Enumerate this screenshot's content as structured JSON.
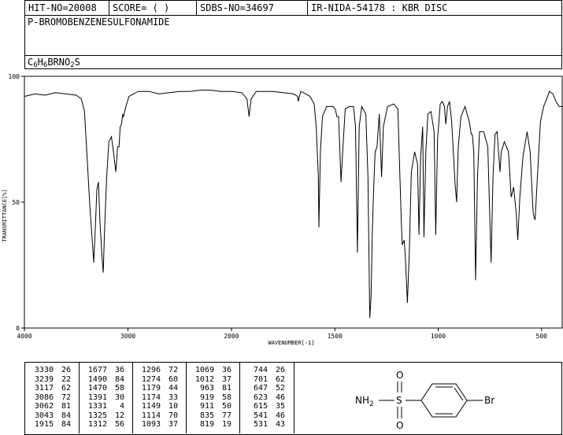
{
  "header": {
    "hit_no": "HIT-NO=20008",
    "score": "SCORE=  (   )",
    "sdbs_no": "SDBS-NO=34697",
    "ir_nida": "IR-NIDA-54178 : KBR DISC"
  },
  "compound": {
    "name": "P-BROMOBENZENESULFONAMIDE",
    "formula_parts": [
      {
        "t": "C",
        "sub": false
      },
      {
        "t": "6",
        "sub": true
      },
      {
        "t": "H",
        "sub": false
      },
      {
        "t": "6",
        "sub": true
      },
      {
        "t": "BRNO",
        "sub": false
      },
      {
        "t": "2",
        "sub": true
      },
      {
        "t": "S",
        "sub": false
      }
    ]
  },
  "chart_data": {
    "type": "line",
    "xlabel": "WAVENUMBER[-1]",
    "ylabel": "TRANSMITTANCE[%]",
    "xlim": [
      4000,
      400
    ],
    "ylim": [
      0,
      100
    ],
    "x_ticks": [
      4000,
      3000,
      2000,
      1500,
      1000,
      500
    ],
    "y_ticks": [
      0,
      50,
      100
    ],
    "series": [
      {
        "points": [
          [
            4000,
            92
          ],
          [
            3900,
            93
          ],
          [
            3800,
            92.5
          ],
          [
            3700,
            93.5
          ],
          [
            3600,
            93
          ],
          [
            3500,
            92.5
          ],
          [
            3450,
            91
          ],
          [
            3420,
            86
          ],
          [
            3400,
            72
          ],
          [
            3370,
            50
          ],
          [
            3345,
            35
          ],
          [
            3330,
            26
          ],
          [
            3315,
            40
          ],
          [
            3300,
            55
          ],
          [
            3285,
            58
          ],
          [
            3270,
            42
          ],
          [
            3250,
            28
          ],
          [
            3239,
            22
          ],
          [
            3225,
            40
          ],
          [
            3205,
            60
          ],
          [
            3185,
            74
          ],
          [
            3160,
            76
          ],
          [
            3140,
            70
          ],
          [
            3117,
            62
          ],
          [
            3100,
            72
          ],
          [
            3086,
            72
          ],
          [
            3075,
            80
          ],
          [
            3062,
            81
          ],
          [
            3050,
            85
          ],
          [
            3043,
            84
          ],
          [
            3020,
            88
          ],
          [
            2990,
            92
          ],
          [
            2950,
            93
          ],
          [
            2900,
            94
          ],
          [
            2800,
            94
          ],
          [
            2700,
            93
          ],
          [
            2600,
            93.5
          ],
          [
            2500,
            94
          ],
          [
            2400,
            94
          ],
          [
            2300,
            94.5
          ],
          [
            2200,
            94.5
          ],
          [
            2100,
            94
          ],
          [
            2000,
            94
          ],
          [
            1950,
            93.5
          ],
          [
            1925,
            91
          ],
          [
            1915,
            84
          ],
          [
            1905,
            91
          ],
          [
            1880,
            94
          ],
          [
            1800,
            94
          ],
          [
            1700,
            93
          ],
          [
            1680,
            92
          ],
          [
            1677,
            90
          ],
          [
            1665,
            94
          ],
          [
            1640,
            93
          ],
          [
            1620,
            92
          ],
          [
            1600,
            89
          ],
          [
            1590,
            80
          ],
          [
            1580,
            60
          ],
          [
            1577,
            40
          ],
          [
            1570,
            70
          ],
          [
            1560,
            84
          ],
          [
            1540,
            88
          ],
          [
            1510,
            88
          ],
          [
            1498,
            87
          ],
          [
            1490,
            84
          ],
          [
            1482,
            84
          ],
          [
            1470,
            58
          ],
          [
            1462,
            70
          ],
          [
            1450,
            87
          ],
          [
            1430,
            88
          ],
          [
            1410,
            88
          ],
          [
            1400,
            80
          ],
          [
            1391,
            30
          ],
          [
            1382,
            80
          ],
          [
            1370,
            88
          ],
          [
            1350,
            85
          ],
          [
            1340,
            60
          ],
          [
            1331,
            4
          ],
          [
            1325,
            12
          ],
          [
            1318,
            40
          ],
          [
            1312,
            56
          ],
          [
            1305,
            70
          ],
          [
            1296,
            72
          ],
          [
            1285,
            85
          ],
          [
            1274,
            60
          ],
          [
            1265,
            80
          ],
          [
            1245,
            88
          ],
          [
            1215,
            89
          ],
          [
            1195,
            87
          ],
          [
            1185,
            60
          ],
          [
            1179,
            44
          ],
          [
            1174,
            33
          ],
          [
            1165,
            35
          ],
          [
            1160,
            30
          ],
          [
            1149,
            10
          ],
          [
            1140,
            30
          ],
          [
            1130,
            62
          ],
          [
            1114,
            70
          ],
          [
            1100,
            65
          ],
          [
            1093,
            37
          ],
          [
            1085,
            68
          ],
          [
            1075,
            80
          ],
          [
            1069,
            36
          ],
          [
            1060,
            70
          ],
          [
            1050,
            85
          ],
          [
            1035,
            86
          ],
          [
            1020,
            78
          ],
          [
            1012,
            37
          ],
          [
            1003,
            75
          ],
          [
            990,
            89
          ],
          [
            980,
            90
          ],
          [
            970,
            88
          ],
          [
            963,
            81
          ],
          [
            955,
            88
          ],
          [
            945,
            90
          ],
          [
            935,
            82
          ],
          [
            919,
            58
          ],
          [
            911,
            50
          ],
          [
            903,
            72
          ],
          [
            890,
            84
          ],
          [
            870,
            88
          ],
          [
            850,
            82
          ],
          [
            840,
            77
          ],
          [
            835,
            77
          ],
          [
            828,
            70
          ],
          [
            819,
            19
          ],
          [
            810,
            60
          ],
          [
            800,
            78
          ],
          [
            780,
            78
          ],
          [
            760,
            72
          ],
          [
            744,
            26
          ],
          [
            735,
            60
          ],
          [
            725,
            77
          ],
          [
            715,
            78
          ],
          [
            701,
            62
          ],
          [
            695,
            70
          ],
          [
            680,
            74
          ],
          [
            660,
            70
          ],
          [
            647,
            52
          ],
          [
            635,
            56
          ],
          [
            623,
            46
          ],
          [
            615,
            35
          ],
          [
            605,
            52
          ],
          [
            590,
            68
          ],
          [
            570,
            78
          ],
          [
            555,
            70
          ],
          [
            541,
            46
          ],
          [
            536,
            44
          ],
          [
            531,
            43
          ],
          [
            520,
            60
          ],
          [
            505,
            82
          ],
          [
            490,
            88
          ],
          [
            475,
            91
          ],
          [
            462,
            94
          ],
          [
            445,
            93
          ],
          [
            430,
            90
          ],
          [
            415,
            88
          ],
          [
            400,
            88
          ]
        ]
      }
    ]
  },
  "peaks": {
    "columns": [
      [
        [
          "3330",
          "26"
        ],
        [
          "3239",
          "22"
        ],
        [
          "3117",
          "62"
        ],
        [
          "3086",
          "72"
        ],
        [
          "3062",
          "81"
        ],
        [
          "3043",
          "84"
        ],
        [
          "1915",
          "84"
        ]
      ],
      [
        [
          "1677",
          "36"
        ],
        [
          "1490",
          "84"
        ],
        [
          "1470",
          "58"
        ],
        [
          "1391",
          "30"
        ],
        [
          "1331",
          "4"
        ],
        [
          "1325",
          "12"
        ],
        [
          "1312",
          "56"
        ]
      ],
      [
        [
          "1296",
          "72"
        ],
        [
          "1274",
          "60"
        ],
        [
          "1179",
          "44"
        ],
        [
          "1174",
          "33"
        ],
        [
          "1149",
          "10"
        ],
        [
          "1114",
          "70"
        ],
        [
          "1093",
          "37"
        ]
      ],
      [
        [
          "1069",
          "36"
        ],
        [
          "1012",
          "37"
        ],
        [
          "963",
          "81"
        ],
        [
          "919",
          "58"
        ],
        [
          "911",
          "50"
        ],
        [
          "835",
          "77"
        ],
        [
          "819",
          "19"
        ]
      ],
      [
        [
          "744",
          "26"
        ],
        [
          "701",
          "62"
        ],
        [
          "647",
          "52"
        ],
        [
          "623",
          "46"
        ],
        [
          "615",
          "35"
        ],
        [
          "541",
          "46"
        ],
        [
          "531",
          "43"
        ]
      ]
    ]
  },
  "structure": {
    "nh2": "NH",
    "nh2_sub": "2",
    "s": "S",
    "o_top": "O",
    "o_bottom": "O",
    "br": "Br"
  }
}
